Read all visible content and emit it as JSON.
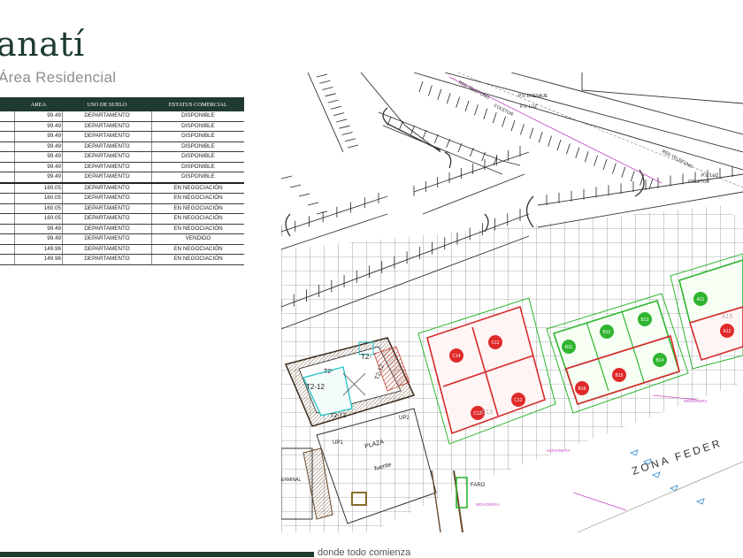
{
  "header": {
    "title": "anatí",
    "subtitle": "Área Residencial"
  },
  "table": {
    "columns": [
      "",
      "AREA",
      "USO DE SUELO",
      "ESTATUS COMERCIAL"
    ],
    "rows": [
      {
        "area": "99.49",
        "uso": "DEPARTAMENTO",
        "estatus": "DISPONIBLE"
      },
      {
        "area": "99.49",
        "uso": "DEPARTAMENTO",
        "estatus": "DISPONIBLE"
      },
      {
        "area": "99.49",
        "uso": "DEPARTAMENTO",
        "estatus": "DISPONIBLE"
      },
      {
        "area": "99.49",
        "uso": "DEPARTAMENTO",
        "estatus": "DISPONIBLE"
      },
      {
        "area": "99.49",
        "uso": "DEPARTAMENTO",
        "estatus": "DISPONIBLE"
      },
      {
        "area": "99.49",
        "uso": "DEPARTAMENTO",
        "estatus": "DISPONIBLE"
      },
      {
        "area": "99.49",
        "uso": "DEPARTAMENTO",
        "estatus": "DISPONIBLE"
      },
      {
        "area": "160.05",
        "uso": "DEPARTAMENTO",
        "estatus": "EN NEGOCIACIÓN"
      },
      {
        "area": "160.05",
        "uso": "DEPARTAMENTO",
        "estatus": "EN NEGOCIACIÓN"
      },
      {
        "area": "160.05",
        "uso": "DEPARTAMENTO",
        "estatus": "EN NEGOCIACIÓN"
      },
      {
        "area": "160.05",
        "uso": "DEPARTAMENTO",
        "estatus": "EN NEGOCIACIÓN"
      },
      {
        "area": "99.49",
        "uso": "DEPARTAMENTO",
        "estatus": "EN NEGOCIACIÓN"
      },
      {
        "area": "99.49",
        "uso": "DEPARTAMENTO",
        "estatus": "VENDIDO"
      },
      {
        "area": "149.96",
        "uso": "DEPARTAMENTO",
        "estatus": "EN NEGOCIACIÓN"
      },
      {
        "area": "149.96",
        "uso": "DEPARTAMENTO",
        "estatus": "EN NEGOCIACIÓN"
      }
    ]
  },
  "plan": {
    "labels": {
      "red_telefono_1": "RED TELEFONO",
      "red_telefono_2": "RED TELEFONO",
      "pv_drenaje": "P.V. DRENAJE",
      "pv_luz_1": "P.V. LUZ",
      "pv_luz_2": "P.V. LUZ",
      "coletor_1": "COLETOR",
      "coletor_2": "COLETOR",
      "t2_12_a": "T2-12",
      "t2_12_b": "T2-12",
      "t2_12_c": "T2-12",
      "t2_a": "T2-",
      "t2_b": "T2-",
      "plaza": "PLAZA",
      "fuente": "fuente",
      "up1": "UP1",
      "up2": "UP2",
      "terminal": "ERMINAL",
      "faro": "FARO",
      "mohonera_1": "MOHONERA",
      "mohonera_2": "MOHONERA",
      "mohonera_3": "MOHONERA",
      "zona_federal": "ZONA FEDER",
      "a15": "A15",
      "c13": "C13"
    },
    "markers": [
      {
        "label": "C14",
        "status": "red"
      },
      {
        "label": "C11",
        "status": "red"
      },
      {
        "label": "C12",
        "status": "red"
      },
      {
        "label": "C12",
        "status": "red"
      },
      {
        "label": "B11",
        "status": "green"
      },
      {
        "label": "B12",
        "status": "green"
      },
      {
        "label": "B13",
        "status": "green"
      },
      {
        "label": "B14",
        "status": "green"
      },
      {
        "label": "B16",
        "status": "red"
      },
      {
        "label": "B15",
        "status": "red"
      },
      {
        "label": "A11",
        "status": "green"
      },
      {
        "label": "A12",
        "status": "red"
      }
    ]
  },
  "footer": {
    "tagline": "donde todo comienza"
  },
  "colors": {
    "brand": "#1f3a2e",
    "available": "#2fb52f",
    "sold": "#e02a2a"
  }
}
